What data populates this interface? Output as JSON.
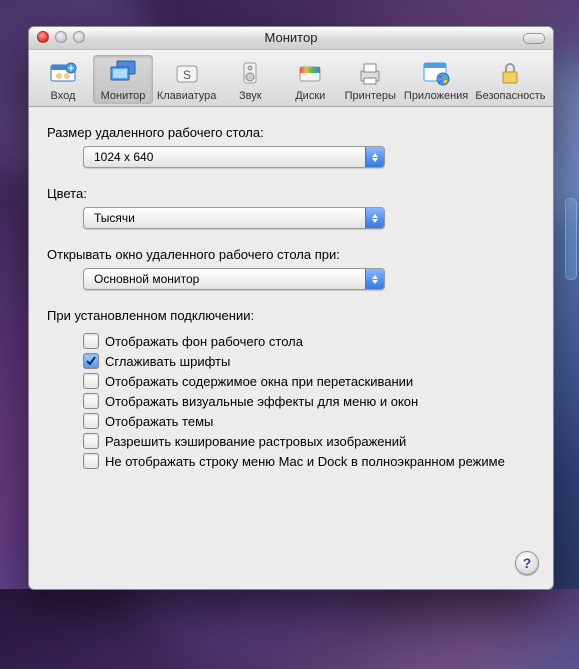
{
  "window": {
    "title": "Монитор"
  },
  "toolbar": {
    "items": [
      {
        "label": "Вход",
        "icon": "login-icon",
        "active": false
      },
      {
        "label": "Монитор",
        "icon": "monitor-icon",
        "active": true
      },
      {
        "label": "Клавиатура",
        "icon": "keyboard-icon",
        "active": false
      },
      {
        "label": "Звук",
        "icon": "sound-icon",
        "active": false
      },
      {
        "label": "Диски",
        "icon": "disks-icon",
        "active": false
      },
      {
        "label": "Принтеры",
        "icon": "printers-icon",
        "active": false
      },
      {
        "label": "Приложения",
        "icon": "applications-icon",
        "active": false
      },
      {
        "label": "Безопасность",
        "icon": "security-icon",
        "active": false
      }
    ]
  },
  "content": {
    "remote_size_label": "Размер удаленного рабочего стола:",
    "remote_size_value": "1024 x 640",
    "colors_label": "Цвета:",
    "colors_value": "Тысячи",
    "open_on_label": "Открывать окно удаленного рабочего стола при:",
    "open_on_value": "Основной монитор",
    "while_connected_label": "При установленном подключении:",
    "checkboxes": [
      {
        "label": "Отображать фон рабочего стола",
        "checked": false
      },
      {
        "label": "Сглаживать шрифты",
        "checked": true
      },
      {
        "label": "Отображать содержимое окна при перетаскивании",
        "checked": false
      },
      {
        "label": "Отображать визуальные эффекты для меню и окон",
        "checked": false
      },
      {
        "label": "Отображать темы",
        "checked": false
      },
      {
        "label": "Разрешить кэширование растровых изображений",
        "checked": false
      },
      {
        "label": "Не отображать строку меню Mac и Dock в полноэкранном режиме",
        "checked": false
      }
    ]
  },
  "help": "?"
}
